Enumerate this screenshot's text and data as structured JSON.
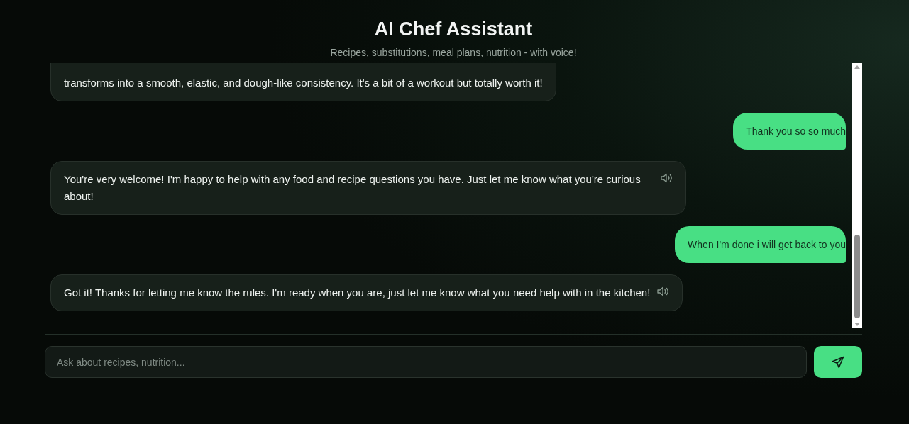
{
  "header": {
    "title": "AI Chef Assistant",
    "subtitle": "Recipes, substitutions, meal plans, nutrition - with voice!"
  },
  "messages": [
    {
      "kind": "bot",
      "text": "transforms into a smooth, elastic, and dough-like consistency. It's a bit of a workout but totally worth it!",
      "speaker": false
    },
    {
      "kind": "user",
      "text": "Thank you so so much"
    },
    {
      "kind": "bot",
      "text": "You're very welcome! I'm happy to help with any food and recipe questions you have. Just let me know what you're curious about!",
      "speaker": true
    },
    {
      "kind": "user",
      "text": "When I'm done i will get back to you"
    },
    {
      "kind": "bot",
      "text": "Got it! Thanks for letting me know the rules. I'm ready when you are, just let me know what you need help with in the kitchen!",
      "speaker": true
    }
  ],
  "composer": {
    "placeholder": "Ask about recipes, nutrition..."
  }
}
